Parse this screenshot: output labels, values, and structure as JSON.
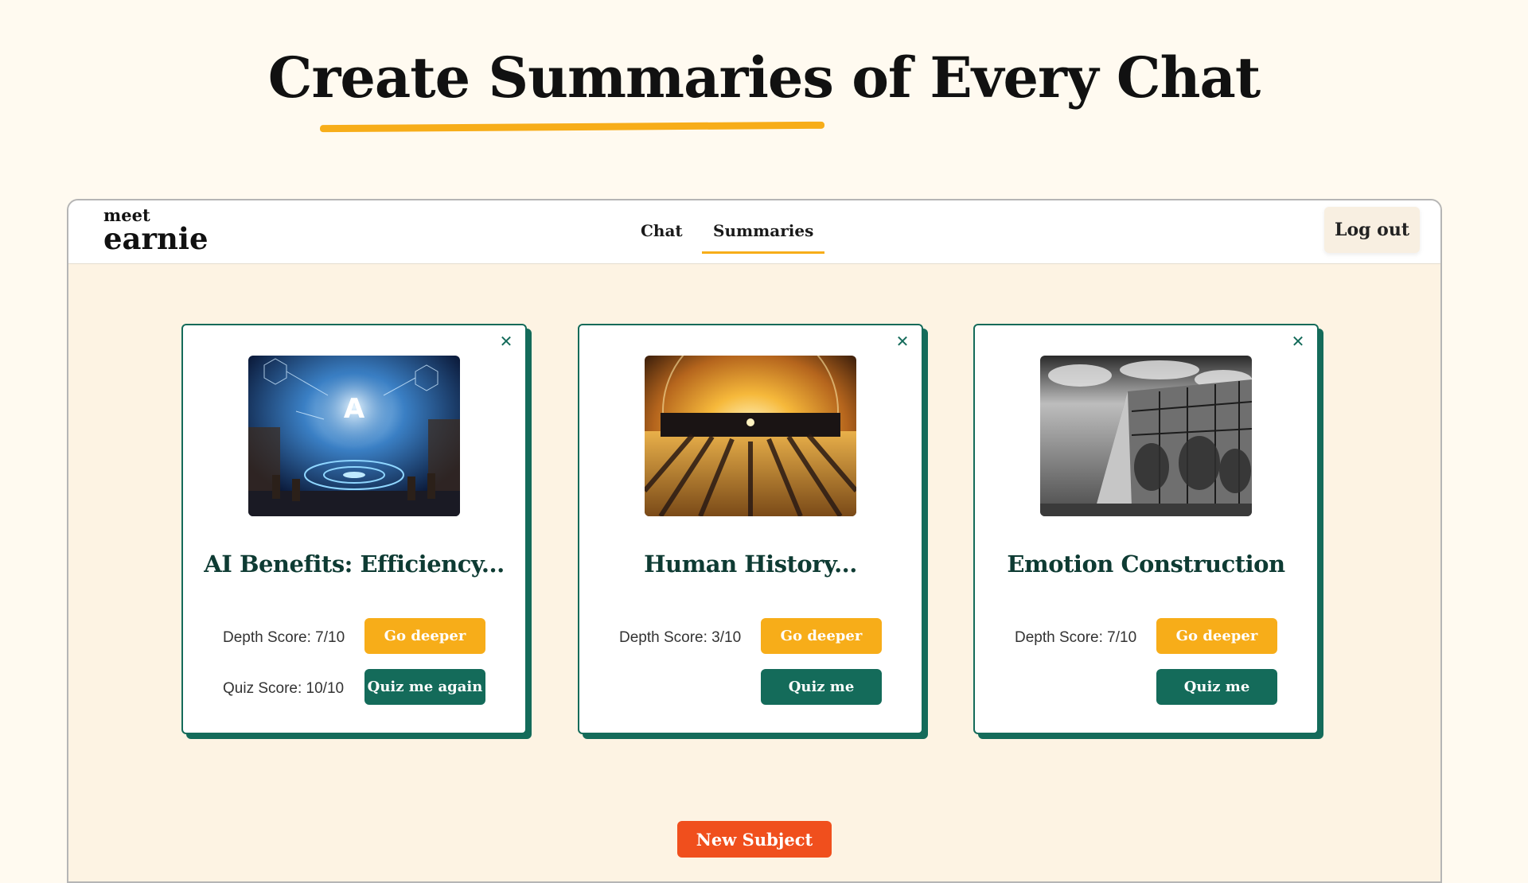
{
  "headline": "Create Summaries of Every Chat",
  "app": {
    "logo_small": "meet",
    "logo_big": "earnie",
    "tabs": [
      {
        "label": "Chat",
        "active": false
      },
      {
        "label": "Summaries",
        "active": true
      }
    ],
    "logout_label": "Log out"
  },
  "cards": [
    {
      "title": "AI Benefits: Efficiency...",
      "image": "ai-network-illustration",
      "depth_score": "Depth Score: 7/10",
      "quiz_score": "Quiz Score: 10/10",
      "deeper_label": "Go deeper",
      "quiz_label": "Quiz me again",
      "close_icon": "close-icon"
    },
    {
      "title": "Human History...",
      "image": "crowd-silhouettes-sunrise",
      "depth_score": "Depth Score: 3/10",
      "quiz_score": "",
      "deeper_label": "Go deeper",
      "quiz_label": "Quiz me",
      "close_icon": "close-icon"
    },
    {
      "title": "Emotion Construction",
      "image": "glass-building-black-and-white",
      "depth_score": "Depth Score: 7/10",
      "quiz_score": "",
      "deeper_label": "Go deeper",
      "quiz_label": "Quiz me",
      "close_icon": "close-icon"
    }
  ],
  "new_subject_label": "New Subject",
  "colors": {
    "background": "#fffaf0",
    "panel": "#fdf3e3",
    "accent_yellow": "#f7ad19",
    "accent_green": "#146b5a",
    "accent_orange": "#f04f1d",
    "title_green": "#0e3b33"
  }
}
